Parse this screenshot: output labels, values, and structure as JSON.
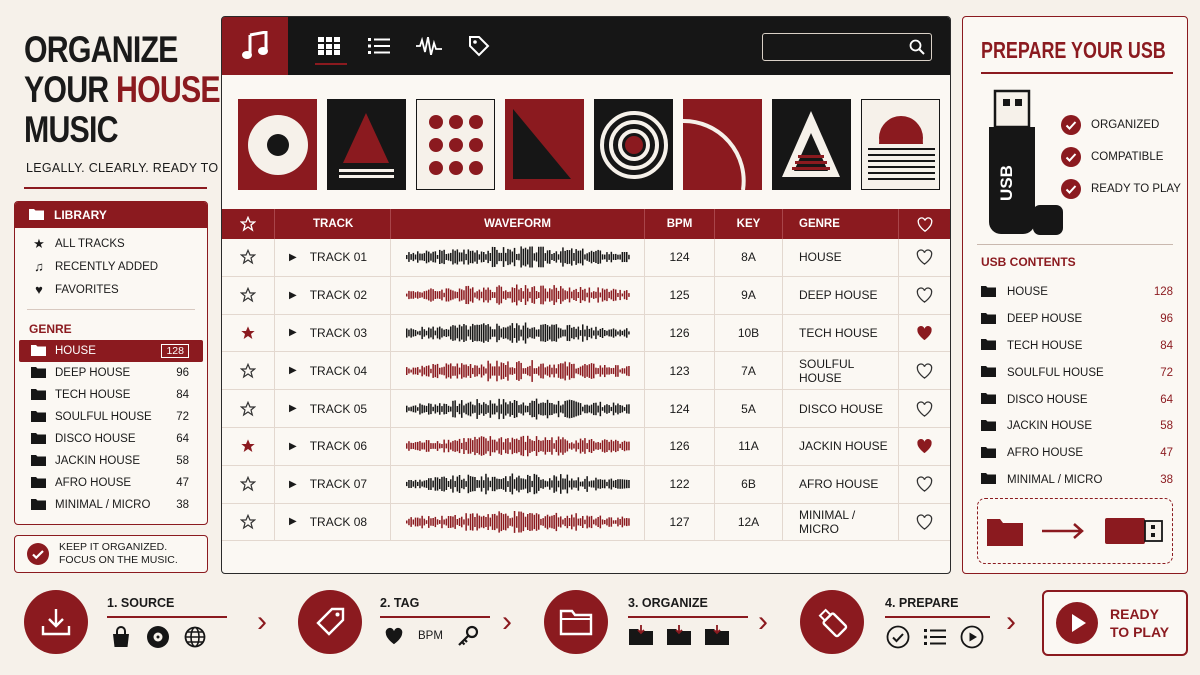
{
  "colors": {
    "accent": "#8b1a1f",
    "dark": "#161616",
    "background": "#f6f1ea"
  },
  "headline": {
    "line1": "ORGANIZE",
    "line2_a": "YOUR ",
    "line2_b": "HOUSE",
    "line3": "MUSIC",
    "tagline": "LEGALLY. CLEARLY. READY TO PLAY."
  },
  "library": {
    "title": "LIBRARY",
    "items": [
      {
        "label": "ALL TRACKS",
        "icon": "star-icon"
      },
      {
        "label": "RECENTLY ADDED",
        "icon": "music-note-icon"
      },
      {
        "label": "FAVORITES",
        "icon": "heart-icon"
      }
    ],
    "genre_title": "GENRE",
    "genres": [
      {
        "name": "HOUSE",
        "count": "128",
        "active": true
      },
      {
        "name": "DEEP HOUSE",
        "count": "96"
      },
      {
        "name": "TECH HOUSE",
        "count": "84"
      },
      {
        "name": "SOULFUL HOUSE",
        "count": "72"
      },
      {
        "name": "DISCO HOUSE",
        "count": "64"
      },
      {
        "name": "JACKIN HOUSE",
        "count": "58"
      },
      {
        "name": "AFRO HOUSE",
        "count": "47"
      },
      {
        "name": "MINIMAL / MICRO",
        "count": "38"
      }
    ]
  },
  "keep": {
    "line1": "KEEP IT ORGANIZED.",
    "line2": "FOCUS ON THE MUSIC."
  },
  "toolbar": {
    "views": [
      "grid-view-icon",
      "list-view-icon",
      "waveform-view-icon",
      "tag-view-icon"
    ],
    "search_placeholder": ""
  },
  "table": {
    "headers": {
      "track": "TRACK",
      "waveform": "WAVEFORM",
      "bpm": "BPM",
      "key": "KEY",
      "genre": "GENRE"
    },
    "rows": [
      {
        "track": "TRACK 01",
        "bpm": "124",
        "key": "8A",
        "genre": "HOUSE",
        "fav": false,
        "wave": "dark"
      },
      {
        "track": "TRACK 02",
        "bpm": "125",
        "key": "9A",
        "genre": "DEEP HOUSE",
        "fav": false,
        "wave": "red"
      },
      {
        "track": "TRACK 03",
        "bpm": "126",
        "key": "10B",
        "genre": "TECH HOUSE",
        "fav": true,
        "wave": "dark"
      },
      {
        "track": "TRACK 04",
        "bpm": "123",
        "key": "7A",
        "genre": "SOULFUL HOUSE",
        "fav": false,
        "wave": "red"
      },
      {
        "track": "TRACK 05",
        "bpm": "124",
        "key": "5A",
        "genre": "DISCO HOUSE",
        "fav": false,
        "wave": "dark"
      },
      {
        "track": "TRACK 06",
        "bpm": "126",
        "key": "11A",
        "genre": "JACKIN HOUSE",
        "fav": true,
        "wave": "red"
      },
      {
        "track": "TRACK 07",
        "bpm": "122",
        "key": "6B",
        "genre": "AFRO HOUSE",
        "fav": false,
        "wave": "dark"
      },
      {
        "track": "TRACK 08",
        "bpm": "127",
        "key": "12A",
        "genre": "MINIMAL / MICRO",
        "fav": false,
        "wave": "red"
      }
    ]
  },
  "usb": {
    "title": "PREPARE YOUR USB",
    "drive_label": "USB",
    "checks": [
      "ORGANIZED",
      "COMPATIBLE",
      "READY TO PLAY"
    ],
    "contents_title": "USB CONTENTS",
    "contents": [
      {
        "name": "HOUSE",
        "count": "128"
      },
      {
        "name": "DEEP HOUSE",
        "count": "96"
      },
      {
        "name": "TECH HOUSE",
        "count": "84"
      },
      {
        "name": "SOULFUL HOUSE",
        "count": "72"
      },
      {
        "name": "DISCO HOUSE",
        "count": "64"
      },
      {
        "name": "JACKIN HOUSE",
        "count": "58"
      },
      {
        "name": "AFRO HOUSE",
        "count": "47"
      },
      {
        "name": "MINIMAL / MICRO",
        "count": "38"
      }
    ]
  },
  "steps": [
    {
      "label": "1. SOURCE",
      "icon": "download-icon"
    },
    {
      "label": "2. TAG",
      "icon": "tag-icon",
      "bpm": "BPM"
    },
    {
      "label": "3. ORGANIZE",
      "icon": "folder-icon"
    },
    {
      "label": "4. PREPARE",
      "icon": "usb-icon"
    }
  ],
  "ready": {
    "line1": "READY",
    "line2": "TO PLAY"
  }
}
